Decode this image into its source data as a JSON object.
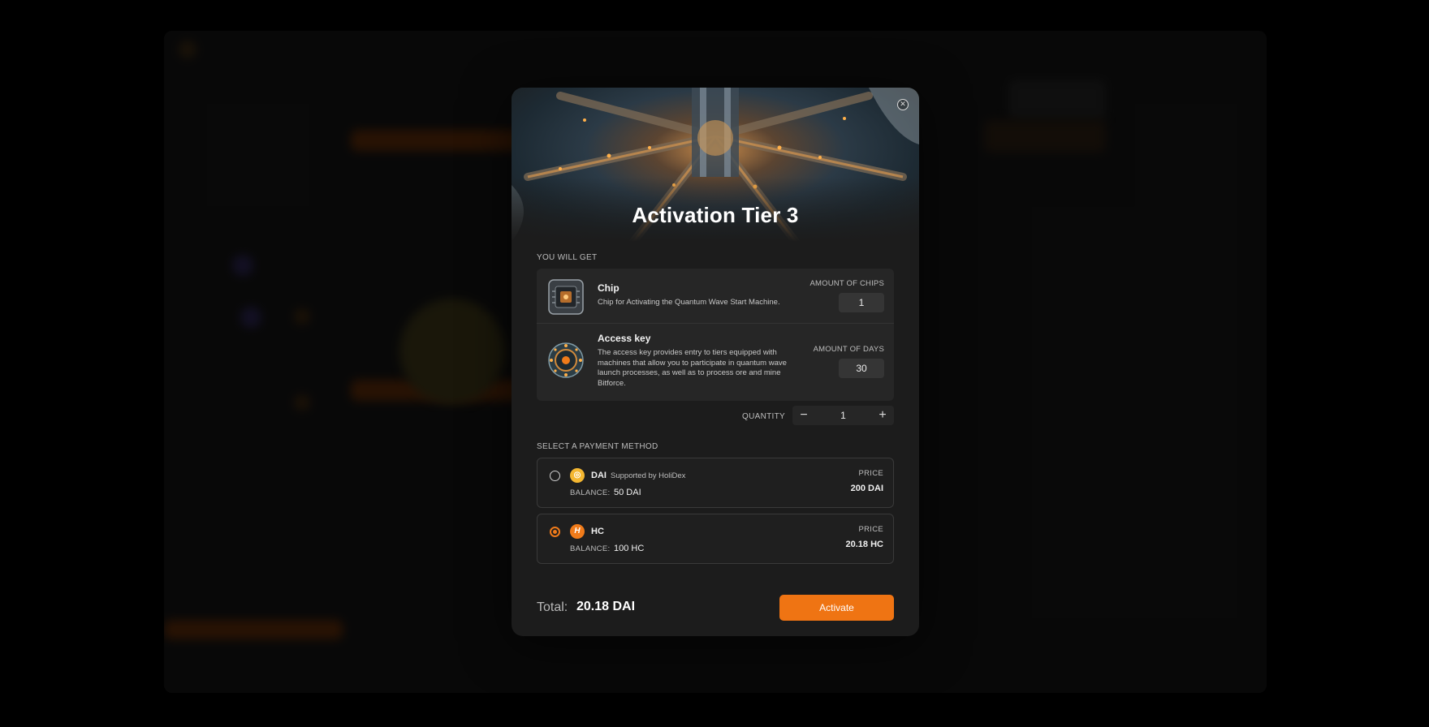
{
  "modal": {
    "title": "Activation Tier 3",
    "close_icon": "close-icon",
    "you_will_get_label": "YOU WILL GET",
    "items": [
      {
        "name": "Chip",
        "description": "Chip for Activating the Quantum Wave Start Machine.",
        "amount_label": "AMOUNT OF CHIPS",
        "amount_value": "1"
      },
      {
        "name": "Access key",
        "description": "The access key provides entry to tiers equipped with machines that allow you to participate in quantum wave launch processes, as well as to process ore and mine Bitforce.",
        "amount_label": "AMOUNT OF DAYS",
        "amount_value": "30"
      }
    ],
    "quantity": {
      "label": "QUANTITY",
      "minus": "−",
      "value": "1",
      "plus": "+"
    },
    "payment_label": "SELECT A PAYMENT METHOD",
    "payment_methods": [
      {
        "coin_glyph": "◎",
        "name": "DAI",
        "subtitle": "Supported by HoliDex",
        "balance_label": "BALANCE:",
        "balance_value": "50 DAI",
        "price_label": "PRICE",
        "price_value": "200 DAI",
        "selected": false,
        "color": "#f4b731"
      },
      {
        "coin_glyph": "H",
        "name": "HC",
        "subtitle": "",
        "balance_label": "BALANCE:",
        "balance_value": "100 HC",
        "price_label": "PRICE",
        "price_value": "20.18 HC",
        "selected": true,
        "color": "#f07b1a"
      }
    ],
    "total_label": "Total:",
    "total_value": "20.18 DAI",
    "activate_label": "Activate",
    "accent_color": "#ef7413"
  }
}
